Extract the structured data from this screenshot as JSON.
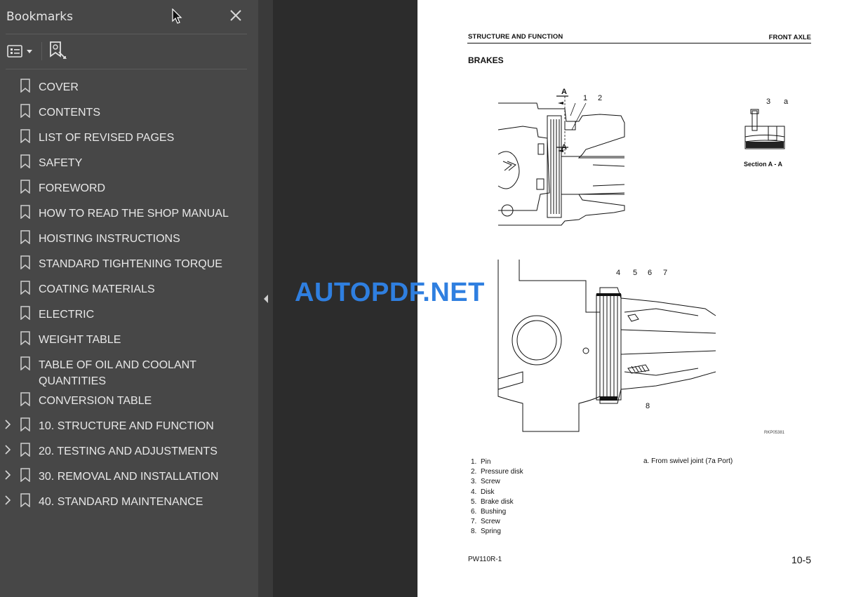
{
  "sidebar": {
    "title": "Bookmarks",
    "items": [
      {
        "label": "COVER",
        "expandable": false
      },
      {
        "label": "CONTENTS",
        "expandable": false
      },
      {
        "label": "LIST OF REVISED PAGES",
        "expandable": false
      },
      {
        "label": "SAFETY",
        "expandable": false
      },
      {
        "label": "FOREWORD",
        "expandable": false
      },
      {
        "label": "HOW TO READ THE SHOP MANUAL",
        "expandable": false
      },
      {
        "label": "HOISTING INSTRUCTIONS",
        "expandable": false
      },
      {
        "label": "STANDARD TIGHTENING TORQUE",
        "expandable": false
      },
      {
        "label": "COATING MATERIALS",
        "expandable": false
      },
      {
        "label": "ELECTRIC",
        "expandable": false
      },
      {
        "label": "WEIGHT TABLE",
        "expandable": false
      },
      {
        "label": "TABLE OF OIL AND COOLANT QUANTITIES",
        "expandable": false
      },
      {
        "label": "CONVERSION TABLE",
        "expandable": false
      },
      {
        "label": "10. STRUCTURE AND FUNCTION",
        "expandable": true
      },
      {
        "label": "20. TESTING AND ADJUSTMENTS",
        "expandable": true
      },
      {
        "label": "30. REMOVAL AND INSTALLATION",
        "expandable": true
      },
      {
        "label": "40. STANDARD MAINTENANCE",
        "expandable": true
      }
    ]
  },
  "icons": {
    "close": "close-icon",
    "options": "bookmark-options-icon",
    "find": "find-current-bookmark-icon",
    "bookmark": "bookmark-icon",
    "chevron": "chevron-right-icon",
    "collapse": "chevron-left-icon"
  },
  "page": {
    "header_left": "STRUCTURE AND FUNCTION",
    "header_right": "FRONT AXLE",
    "section_title": "BRAKES",
    "section_label": "Section A - A",
    "figure_code": "RKP05381",
    "callouts": {
      "a1": "A",
      "a2": "A",
      "n1": "1",
      "n2": "2",
      "n3": "3",
      "na": "a",
      "n4": "4",
      "n5": "5",
      "n6": "6",
      "n7": "7",
      "n8": "8"
    },
    "legend": [
      {
        "num": "1.",
        "text": "Pin"
      },
      {
        "num": "2.",
        "text": "Pressure disk"
      },
      {
        "num": "3.",
        "text": "Screw"
      },
      {
        "num": "4.",
        "text": "Disk"
      },
      {
        "num": "5.",
        "text": "Brake disk"
      },
      {
        "num": "6.",
        "text": "Bushing"
      },
      {
        "num": "7.",
        "text": "Screw"
      },
      {
        "num": "8.",
        "text": "Spring"
      }
    ],
    "legend_right": "a.  From swivel joint (7a Port)",
    "footer_left": "PW110R-1",
    "footer_right": "10-5"
  },
  "watermark": "AUTOPDF.NET",
  "colors": {
    "sidebar_bg": "#474747",
    "canvas_bg": "#2c2c2c",
    "watermark": "#2f7fe0"
  }
}
